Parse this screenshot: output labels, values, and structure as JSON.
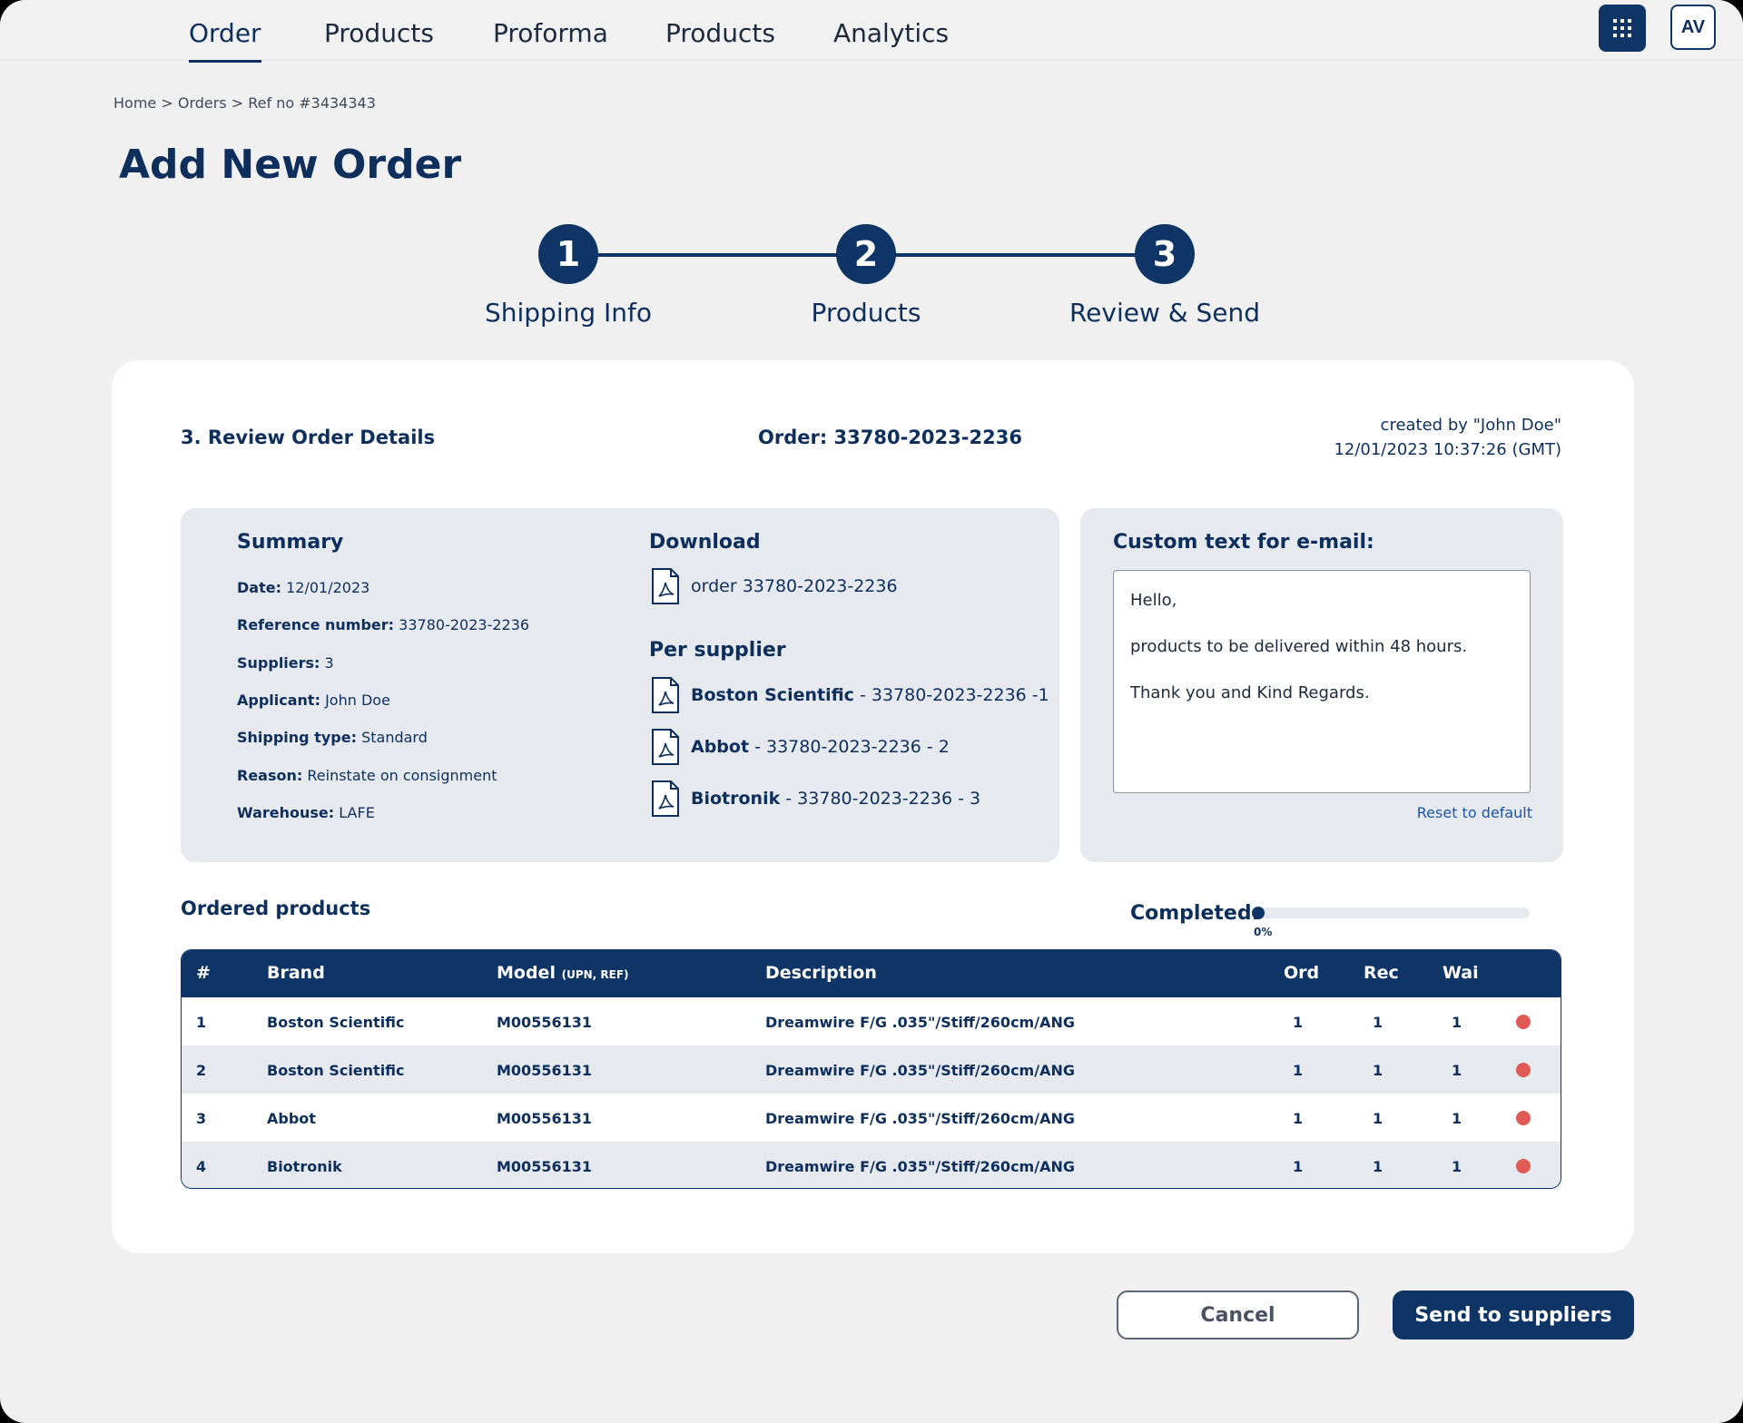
{
  "nav": {
    "items": [
      {
        "label": "Order",
        "active": true
      },
      {
        "label": "Products",
        "active": false
      },
      {
        "label": "Proforma",
        "active": false
      },
      {
        "label": "Products",
        "active": false
      },
      {
        "label": "Analytics",
        "active": false
      }
    ],
    "apps_icon": "grid-icon",
    "avatar": "AV"
  },
  "breadcrumb": {
    "home": "Home",
    "orders": "Orders",
    "ref": "Ref no #3434343",
    "separator": ">"
  },
  "page_title": "Add New Order",
  "stepper": {
    "steps": [
      {
        "number": "1",
        "label": "Shipping Info"
      },
      {
        "number": "2",
        "label": "Products"
      },
      {
        "number": "3",
        "label": "Review & Send"
      }
    ]
  },
  "review": {
    "title": "3. Review Order Details",
    "order_label": "Order: 33780-2023-2236",
    "created_by": "created by \"John Doe\"",
    "created_at": "12/01/2023 10:37:26 (GMT)"
  },
  "summary": {
    "heading": "Summary",
    "rows": [
      {
        "label": "Date:",
        "value": "12/01/2023"
      },
      {
        "label": "Reference number:",
        "value": "33780-2023-2236"
      },
      {
        "label": "Suppliers:",
        "value": "3"
      },
      {
        "label": "Applicant:",
        "value": "John Doe"
      },
      {
        "label": "Shipping type:",
        "value": "Standard"
      },
      {
        "label": "Reason:",
        "value": "Reinstate on consignment"
      },
      {
        "label": "Warehouse:",
        "value": "LAFE"
      }
    ]
  },
  "download": {
    "heading": "Download",
    "order_file": "order 33780-2023-2236",
    "per_supplier_heading": "Per supplier",
    "suppliers": [
      {
        "name": "Boston Scientific",
        "ref": "- 33780-2023-2236 -1"
      },
      {
        "name": "Abbot",
        "ref": "- 33780-2023-2236 - 2"
      },
      {
        "name": "Biotronik",
        "ref": "- 33780-2023-2236 - 3"
      }
    ],
    "file_icon": "pdf-icon"
  },
  "email": {
    "heading": "Custom text for e-mail:",
    "lines": [
      "Hello,",
      "products to be delivered within 48 hours.",
      "Thank you and Kind Regards."
    ],
    "reset_label": "Reset to default"
  },
  "ordered_products": {
    "heading": "Ordered products",
    "completed_label": "Completed:",
    "completed_value": "0%",
    "completed_fraction": 0,
    "columns": {
      "num": "#",
      "brand": "Brand",
      "model": "Model",
      "model_sub": "(UPN, REF)",
      "description": "Description",
      "ord": "Ord",
      "rec": "Rec",
      "wai": "Wai"
    },
    "rows": [
      {
        "num": "1",
        "brand": "Boston Scientific",
        "model": "M00556131",
        "description": "Dreamwire F/G .035\"/Stiff/260cm/ANG",
        "ord": "1",
        "rec": "1",
        "wai": "1",
        "status_color": "#e05a55"
      },
      {
        "num": "2",
        "brand": "Boston Scientific",
        "model": "M00556131",
        "description": "Dreamwire F/G .035\"/Stiff/260cm/ANG",
        "ord": "1",
        "rec": "1",
        "wai": "1",
        "status_color": "#e05a55"
      },
      {
        "num": "3",
        "brand": "Abbot",
        "model": "M00556131",
        "description": "Dreamwire F/G .035\"/Stiff/260cm/ANG",
        "ord": "1",
        "rec": "1",
        "wai": "1",
        "status_color": "#e05a55"
      },
      {
        "num": "4",
        "brand": "Biotronik",
        "model": "M00556131",
        "description": "Dreamwire F/G .035\"/Stiff/260cm/ANG",
        "ord": "1",
        "rec": "1",
        "wai": "1",
        "status_color": "#e05a55"
      }
    ]
  },
  "actions": {
    "cancel": "Cancel",
    "send": "Send to suppliers"
  },
  "colors": {
    "primary": "#0e3566",
    "status_red": "#e05a55",
    "link": "#1a56a6",
    "panel": "#e6e9ee"
  }
}
